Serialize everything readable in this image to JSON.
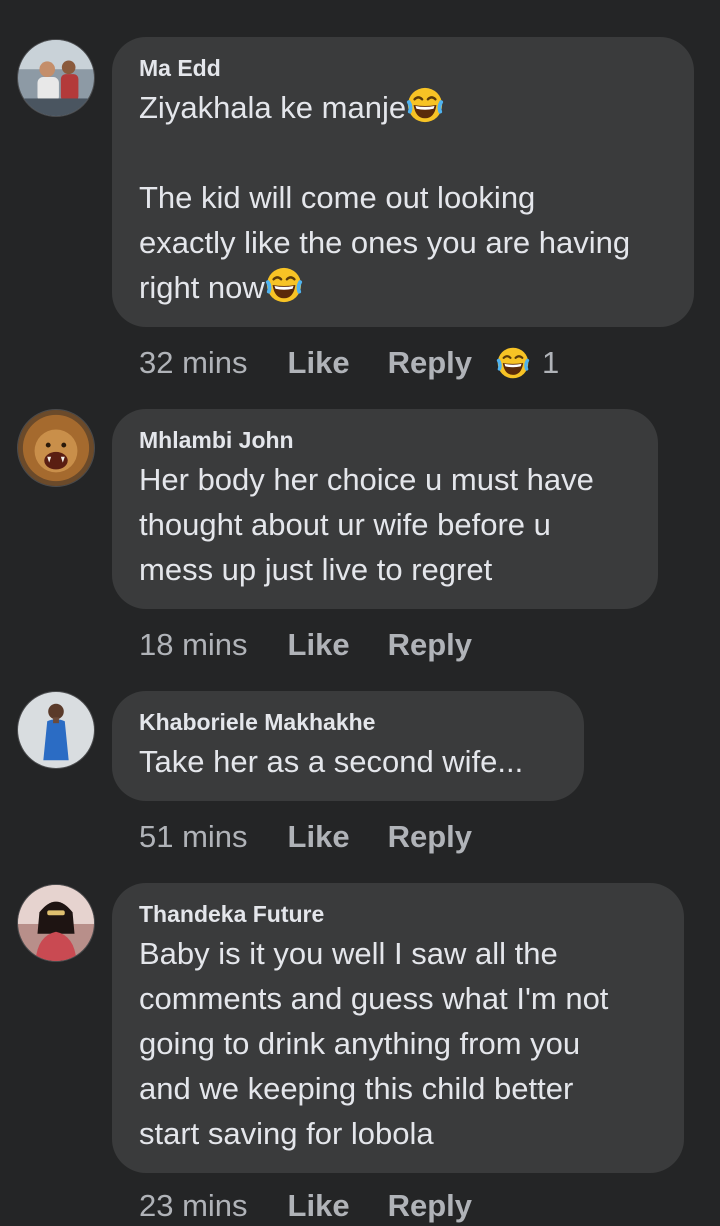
{
  "comments": [
    {
      "author": "Ma Edd",
      "text1": "Ziyakhala ke manje",
      "text2": "The kid will come out looking\nexactly like the ones you are having\nright now",
      "time": "32 mins",
      "like": "Like",
      "reply": "Reply",
      "reaction_icon": "laughing-emoji-icon",
      "reaction_count": "1"
    },
    {
      "author": "Mhlambi John",
      "text": "Her body her choice u must have\nthought about ur wife before u\nmess up just live to regret",
      "time": "18 mins",
      "like": "Like",
      "reply": "Reply"
    },
    {
      "author": "Khaboriele Makhakhe",
      "text": "Take her as a second wife...",
      "time": "51 mins",
      "like": "Like",
      "reply": "Reply"
    },
    {
      "author": "Thandeka Future",
      "text": "Baby is it you well I saw all the\ncomments and guess what I'm not\ngoing to drink anything from you\nand we keeping this child better\nstart saving for lobola",
      "time": "23 mins",
      "like": "Like",
      "reply": "Reply"
    }
  ],
  "colors": {
    "background": "#242526",
    "bubble": "#3a3b3c",
    "text": "#e4e6eb",
    "meta": "#b0b3b8",
    "emoji_yellow": "#f7c325"
  }
}
